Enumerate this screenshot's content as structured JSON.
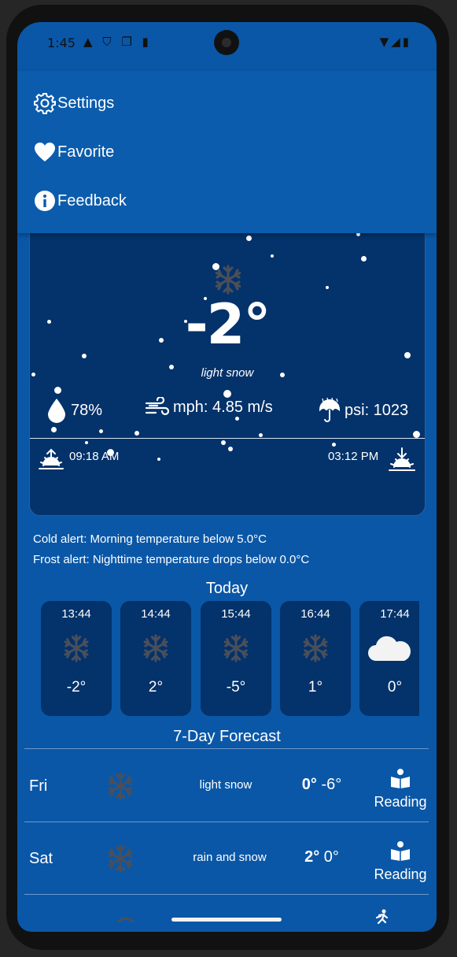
{
  "status_bar": {
    "time": "1:45",
    "left_icons": "▲ ⛉ ❐ ▮",
    "right_icons": "▼◢▮"
  },
  "menu": {
    "items": [
      {
        "label": "Settings",
        "icon": "gear-icon"
      },
      {
        "label": "Favorite",
        "icon": "heart-icon"
      },
      {
        "label": "Feedback",
        "icon": "info-icon"
      }
    ]
  },
  "current": {
    "temperature": "-2°",
    "description": "light snow",
    "humidity": "78%",
    "wind": "mph: 4.85 m/s",
    "pressure": "psi: 1023",
    "sunrise": "09:18 AM",
    "sunset": "03:12 PM",
    "icon": "snowflake-icon"
  },
  "alerts": {
    "cold": "Cold alert: Morning temperature below 5.0°C",
    "frost": "Frost alert: Nighttime temperature drops below 0.0°C"
  },
  "today": {
    "title": "Today",
    "hours": [
      {
        "time": "13:44",
        "temp": "-2°",
        "icon": "snowflake-icon"
      },
      {
        "time": "14:44",
        "temp": "2°",
        "icon": "snowflake-icon"
      },
      {
        "time": "15:44",
        "temp": "-5°",
        "icon": "snowflake-icon"
      },
      {
        "time": "16:44",
        "temp": "1°",
        "icon": "snowflake-icon"
      },
      {
        "time": "17:44",
        "temp": "0°",
        "icon": "cloud-icon"
      }
    ]
  },
  "forecast": {
    "title": "7-Day Forecast",
    "days": [
      {
        "day": "Fri",
        "condition": "light snow",
        "high": "0°",
        "low": "-6°",
        "activity": "Reading",
        "activity_icon": "reading-icon"
      },
      {
        "day": "Sat",
        "condition": "rain and snow",
        "high": "2°",
        "low": "0°",
        "activity": "Reading",
        "activity_icon": "reading-icon"
      }
    ]
  },
  "colors": {
    "background": "#0a57a7",
    "card": "#04326a",
    "icon_gray": "#4a5566"
  }
}
